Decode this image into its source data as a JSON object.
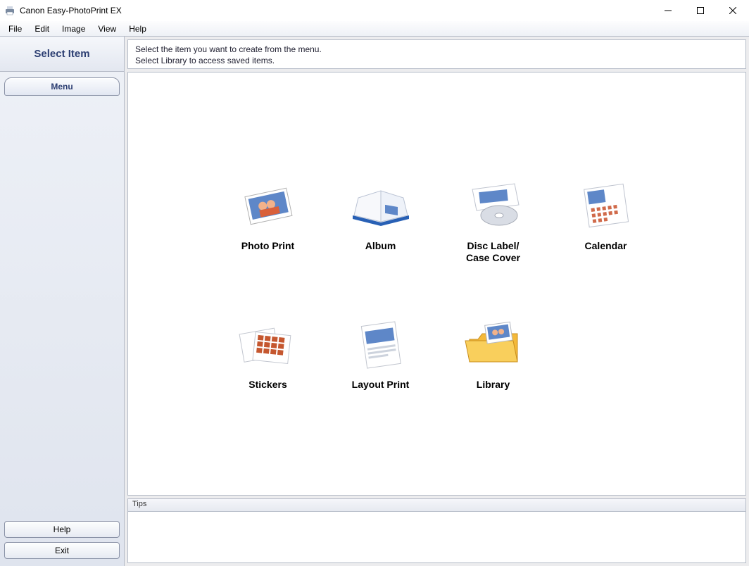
{
  "window": {
    "title": "Canon Easy-PhotoPrint EX"
  },
  "menubar": {
    "file": "File",
    "edit": "Edit",
    "image": "Image",
    "view": "View",
    "help": "Help"
  },
  "sidebar": {
    "step_title": "Select Item",
    "menu_tab": "Menu",
    "help_button": "Help",
    "exit_button": "Exit"
  },
  "instructions": {
    "line1": "Select the item you want to create from the menu.",
    "line2": "Select Library to access saved items."
  },
  "items": {
    "photo_print": "Photo Print",
    "album": "Album",
    "disc_label": "Disc Label/\nCase Cover",
    "calendar": "Calendar",
    "stickers": "Stickers",
    "layout_print": "Layout Print",
    "library": "Library"
  },
  "tips": {
    "header": "Tips"
  }
}
